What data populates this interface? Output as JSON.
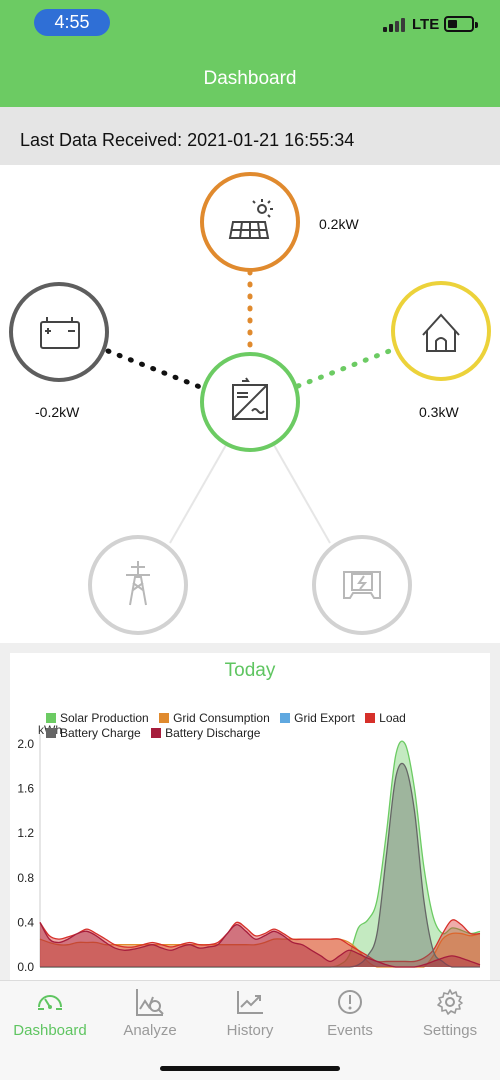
{
  "status_bar": {
    "time": "4:55",
    "network": "LTE",
    "battery_level": 0.3
  },
  "header": {
    "title": "Dashboard"
  },
  "last_data": {
    "text": "Last Data Received: 2021-01-21 16:55:34"
  },
  "flow": {
    "solar": {
      "value": "0.2kW",
      "icon": "solar-panel-icon"
    },
    "battery": {
      "value": "-0.2kW",
      "icon": "battery-icon"
    },
    "home": {
      "value": "0.3kW",
      "icon": "house-icon"
    },
    "inverter": {
      "icon": "inverter-icon"
    },
    "grid": {
      "icon": "power-tower-icon"
    },
    "meter": {
      "icon": "meter-icon"
    }
  },
  "chart": {
    "title": "Today",
    "legend": [
      {
        "name": "Solar Production",
        "color": "#6ccb63"
      },
      {
        "name": "Grid Consumption",
        "color": "#e08a2e"
      },
      {
        "name": "Grid Export",
        "color": "#5fa8e0"
      },
      {
        "name": "Load",
        "color": "#d6302a"
      },
      {
        "name": "Battery Charge",
        "color": "#666666"
      },
      {
        "name": "Battery Discharge",
        "color": "#a61d3c"
      }
    ],
    "ylabel": "kWh"
  },
  "chart_data": {
    "type": "area",
    "title": "Today",
    "ylabel": "kWh",
    "ylim": [
      0,
      2.0
    ],
    "yticks": [
      "0.0",
      "0.4",
      "0.8",
      "1.2",
      "1.6",
      "2.0"
    ],
    "x": [
      0,
      1,
      2,
      3,
      4,
      5,
      6,
      7,
      8,
      9,
      10,
      11,
      12,
      13,
      14,
      15,
      16,
      17,
      18,
      19,
      20,
      21,
      22,
      23,
      24,
      25,
      26,
      27,
      28,
      29,
      30,
      31,
      32,
      33,
      34,
      35,
      36,
      37,
      38,
      39,
      40,
      41,
      42,
      43,
      44,
      45,
      46,
      47
    ],
    "series": [
      {
        "name": "Solar Production",
        "color": "#6ccb63",
        "values": [
          0,
          0,
          0,
          0,
          0,
          0,
          0,
          0,
          0,
          0,
          0,
          0,
          0,
          0,
          0,
          0,
          0,
          0,
          0,
          0,
          0,
          0,
          0,
          0,
          0,
          0,
          0,
          0,
          0,
          0,
          0,
          0,
          0.02,
          0.1,
          0.35,
          0.42,
          0.6,
          1.2,
          1.9,
          2.0,
          1.6,
          0.9,
          0.45,
          0.3,
          0.35,
          0.33,
          0.3,
          0.32
        ]
      },
      {
        "name": "Grid Consumption",
        "color": "#e08a2e",
        "values": [
          0.25,
          0.22,
          0.2,
          0.2,
          0.22,
          0.22,
          0.22,
          0.2,
          0.2,
          0.2,
          0.2,
          0.2,
          0.2,
          0.2,
          0.2,
          0.2,
          0.2,
          0.2,
          0.2,
          0.2,
          0.2,
          0.2,
          0.2,
          0.2,
          0.22,
          0.25,
          0.25,
          0.25,
          0.25,
          0.25,
          0.25,
          0.25,
          0.25,
          0.22,
          0.15,
          0.05,
          0.0,
          0.0,
          0.0,
          0.0,
          0.0,
          0.0,
          0.1,
          0.25,
          0.3,
          0.3,
          0.28,
          0.3
        ]
      },
      {
        "name": "Load",
        "color": "#d6302a",
        "values": [
          0.4,
          0.28,
          0.25,
          0.27,
          0.3,
          0.34,
          0.3,
          0.25,
          0.2,
          0.18,
          0.18,
          0.2,
          0.22,
          0.2,
          0.18,
          0.2,
          0.22,
          0.2,
          0.2,
          0.22,
          0.3,
          0.4,
          0.35,
          0.28,
          0.3,
          0.34,
          0.3,
          0.25,
          0.25,
          0.25,
          0.25,
          0.25,
          0.25,
          0.2,
          0.15,
          0.1,
          0.05,
          0.05,
          0.05,
          0.05,
          0.05,
          0.08,
          0.15,
          0.3,
          0.42,
          0.38,
          0.3,
          0.3
        ]
      },
      {
        "name": "Battery Charge",
        "color": "#666666",
        "values": [
          0,
          0,
          0,
          0,
          0,
          0,
          0,
          0,
          0,
          0,
          0,
          0,
          0,
          0,
          0,
          0,
          0,
          0,
          0,
          0,
          0,
          0,
          0,
          0,
          0,
          0,
          0,
          0,
          0,
          0,
          0,
          0,
          0,
          0,
          0.02,
          0.1,
          0.3,
          1.0,
          1.7,
          1.8,
          1.4,
          0.6,
          0.15,
          0.05,
          0,
          0,
          0,
          0
        ]
      },
      {
        "name": "Battery Discharge",
        "color": "#a61d3c",
        "values": [
          0.4,
          0.25,
          0.22,
          0.25,
          0.3,
          0.32,
          0.28,
          0.22,
          0.17,
          0.15,
          0.16,
          0.18,
          0.2,
          0.17,
          0.15,
          0.18,
          0.2,
          0.17,
          0.18,
          0.2,
          0.3,
          0.38,
          0.32,
          0.25,
          0.28,
          0.32,
          0.28,
          0.22,
          0.2,
          0.15,
          0.1,
          0.05,
          0.1,
          0.15,
          0.12,
          0.08,
          0.05,
          0.02,
          0,
          0,
          0,
          0.02,
          0.05,
          0.08,
          0.1,
          0.08,
          0.05,
          0.02
        ]
      }
    ]
  },
  "tabs": [
    {
      "label": "Dashboard",
      "icon": "gauge-icon",
      "active": true
    },
    {
      "label": "Analyze",
      "icon": "analyze-chart-icon",
      "active": false
    },
    {
      "label": "History",
      "icon": "history-chart-icon",
      "active": false
    },
    {
      "label": "Events",
      "icon": "alert-circle-icon",
      "active": false
    },
    {
      "label": "Settings",
      "icon": "gear-icon",
      "active": false
    }
  ]
}
